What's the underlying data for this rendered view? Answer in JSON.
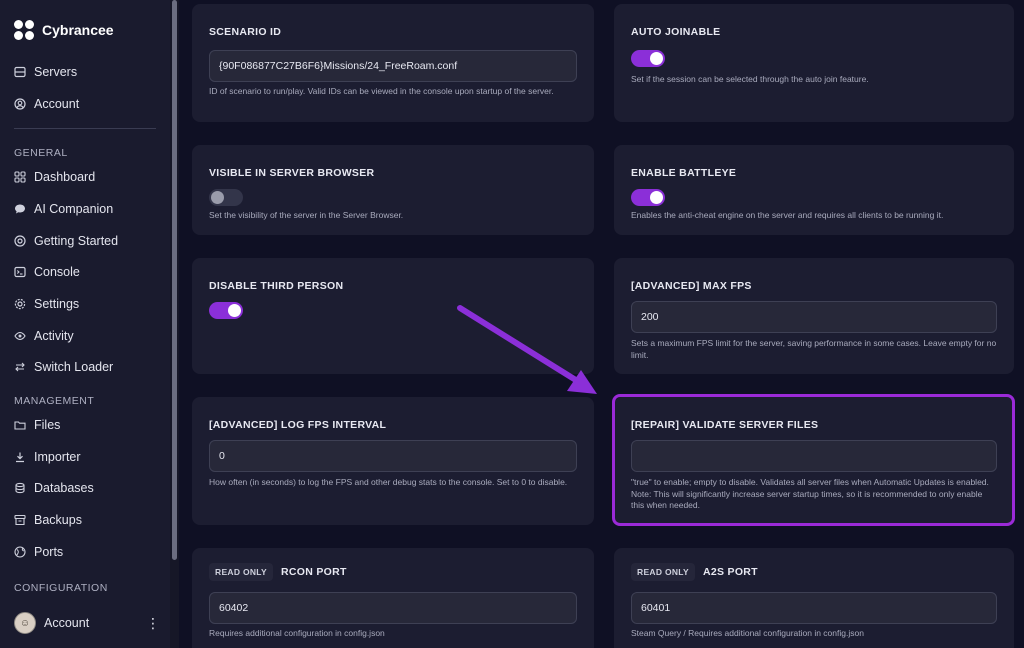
{
  "brand": {
    "name": "Cybrancee"
  },
  "sidebar": {
    "top_items": [
      {
        "label": "Servers",
        "icon": "servers-icon"
      },
      {
        "label": "Account",
        "icon": "account-icon"
      }
    ],
    "sections": [
      {
        "label": "GENERAL",
        "items": [
          {
            "label": "Dashboard",
            "icon": "dashboard-icon"
          },
          {
            "label": "AI Companion",
            "icon": "chat-icon"
          },
          {
            "label": "Getting Started",
            "icon": "lifebuoy-icon"
          },
          {
            "label": "Console",
            "icon": "console-icon"
          },
          {
            "label": "Settings",
            "icon": "gear-icon"
          },
          {
            "label": "Activity",
            "icon": "eye-icon"
          },
          {
            "label": "Switch Loader",
            "icon": "switch-icon"
          }
        ]
      },
      {
        "label": "MANAGEMENT",
        "items": [
          {
            "label": "Files",
            "icon": "folder-icon"
          },
          {
            "label": "Importer",
            "icon": "download-icon"
          },
          {
            "label": "Databases",
            "icon": "database-icon"
          },
          {
            "label": "Backups",
            "icon": "archive-icon"
          },
          {
            "label": "Ports",
            "icon": "globe-icon"
          }
        ]
      },
      {
        "label": "CONFIGURATION",
        "items": []
      }
    ],
    "account": {
      "name": "Account"
    }
  },
  "cards": {
    "scenario_id": {
      "title": "SCENARIO ID",
      "value": "{90F086877C27B6F6}Missions/24_FreeRoam.conf",
      "description": "ID of scenario to run/play. Valid IDs can be viewed in the console upon startup of the server."
    },
    "auto_joinable": {
      "title": "AUTO JOINABLE",
      "enabled": true,
      "description": "Set if the session can be selected through the auto join feature."
    },
    "visible_in_browser": {
      "title": "VISIBLE IN SERVER BROWSER",
      "enabled": false,
      "description": "Set the visibility of the server in the Server Browser."
    },
    "enable_battleye": {
      "title": "ENABLE BATTLEYE",
      "enabled": true,
      "description": "Enables the anti-cheat engine on the server and requires all clients to be running it."
    },
    "disable_third_person": {
      "title": "DISABLE THIRD PERSON",
      "enabled": true
    },
    "max_fps": {
      "title": "[ADVANCED] MAX FPS",
      "value": "200",
      "description": "Sets a maximum FPS limit for the server, saving performance in some cases. Leave empty for no limit."
    },
    "log_fps_interval": {
      "title": "[ADVANCED] LOG FPS INTERVAL",
      "value": "0",
      "description": "How often (in seconds) to log the FPS and other debug stats to the console. Set to 0 to disable."
    },
    "validate_files": {
      "title": "[REPAIR] VALIDATE SERVER FILES",
      "value": "",
      "description": "\"true\" to enable; empty to disable. Validates all server files when Automatic Updates is enabled. Note: This will significantly increase server startup times, so it is recommended to only enable this when needed."
    },
    "rcon_port": {
      "badge": "READ ONLY",
      "title": "RCON PORT",
      "value": "60402",
      "description": "Requires additional configuration in config.json"
    },
    "a2s_port": {
      "badge": "READ ONLY",
      "title": "A2S PORT",
      "value": "60401",
      "description": "Steam Query / Requires additional configuration in config.json"
    }
  },
  "colors": {
    "accent": "#8b2fd8",
    "highlight": "#9b2ad8",
    "card": "#1c1d31",
    "background": "#0f1024"
  }
}
